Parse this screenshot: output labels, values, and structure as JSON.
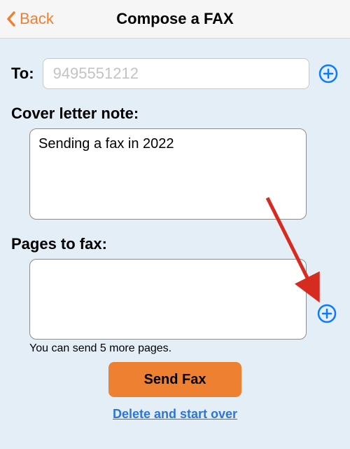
{
  "header": {
    "back_label": "Back",
    "title": "Compose a FAX"
  },
  "to": {
    "label": "To:",
    "placeholder": "9495551212",
    "value": ""
  },
  "cover": {
    "label": "Cover letter note:",
    "value": "Sending a fax in 2022"
  },
  "pages": {
    "label": "Pages to fax:",
    "hint": "You can send 5 more pages."
  },
  "actions": {
    "send_label": "Send Fax",
    "delete_label": "Delete and start over"
  },
  "colors": {
    "accent_orange": "#ee8031",
    "link_blue": "#2e74d9",
    "icon_blue": "#0a7aff",
    "bg": "#e3eef7"
  }
}
